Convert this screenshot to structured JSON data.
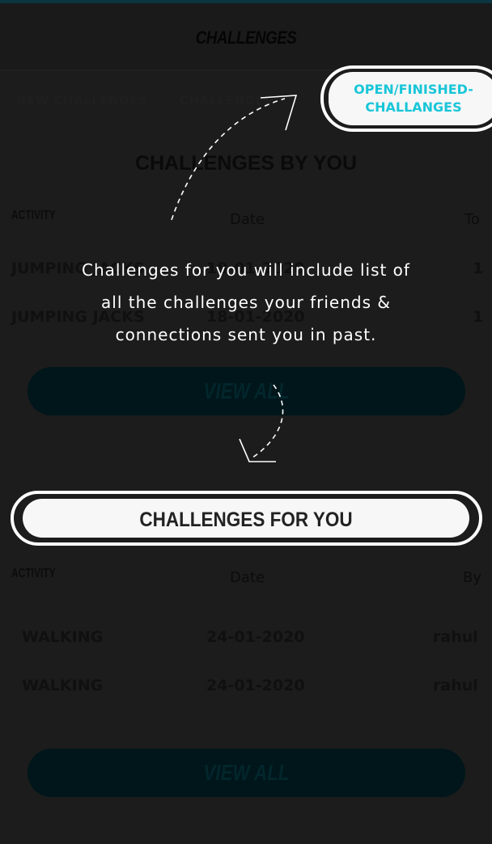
{
  "header": {
    "title": "CHALLENGES"
  },
  "tabs": [
    {
      "label": "NEW CHALLENGES"
    },
    {
      "label": "CHALLENGES"
    }
  ],
  "challenges_by_you": {
    "title": "CHALLENGES BY YOU",
    "columns": [
      "ACTIVITY",
      "Date",
      "To"
    ],
    "rows": [
      {
        "activity": "JUMPING JACKS",
        "date": "18-01-2020",
        "to": "1"
      },
      {
        "activity": "JUMPING JACKS",
        "date": "18-01-2020",
        "to": "1"
      }
    ],
    "view_all": "VIEW ALL"
  },
  "challenges_for_you": {
    "title": "CHALLENGES FOR YOU",
    "columns": [
      "ACTIVITY",
      "Date",
      "By"
    ],
    "rows": [
      {
        "activity": "WALKING",
        "date": "24-01-2020",
        "by": "rahul"
      },
      {
        "activity": "WALKING",
        "date": "24-01-2020",
        "by": "rahul"
      }
    ],
    "view_all": "VIEW ALL"
  },
  "coachmark": {
    "highlight_label_line1": "OPEN/FINISHED-",
    "highlight_label_line2": "CHALLANGES",
    "text_line1": "Challenges for you will include list of",
    "text_line2": "all the challenges your friends &",
    "text_line3": "connections sent you in past."
  },
  "colors": {
    "accent": "#18c6d9",
    "overlay": "#1c1c1c"
  }
}
